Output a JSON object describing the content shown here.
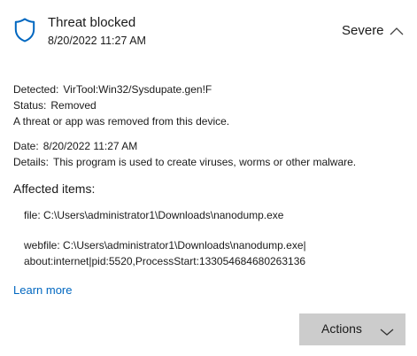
{
  "header": {
    "title": "Threat blocked",
    "timestamp": "8/20/2022 11:27 AM",
    "severity": "Severe",
    "shield_color": "#0067c0"
  },
  "details": {
    "detected_label": "Detected:",
    "detected_value": "VirTool:Win32/Sysdupate.gen!F",
    "status_label": "Status:",
    "status_value": "Removed",
    "status_message": "A threat or app was removed from this device.",
    "date_label": "Date:",
    "date_value": "8/20/2022 11:27 AM",
    "details_label": "Details:",
    "details_value": "This program is used to create viruses, worms or other malware."
  },
  "affected": {
    "title": "Affected items:",
    "items": [
      "file: C:\\Users\\administrator1\\Downloads\\nanodump.exe",
      "webfile: C:\\Users\\administrator1\\Downloads\\nanodump.exe|",
      "about:internet|pid:5520,ProcessStart:133054684680263136"
    ]
  },
  "links": {
    "learn_more": "Learn more"
  },
  "actions": {
    "label": "Actions"
  },
  "icons": {
    "shield": "shield-icon",
    "collapse": "chevron-up-icon",
    "actions_dropdown": "chevron-down-icon"
  }
}
